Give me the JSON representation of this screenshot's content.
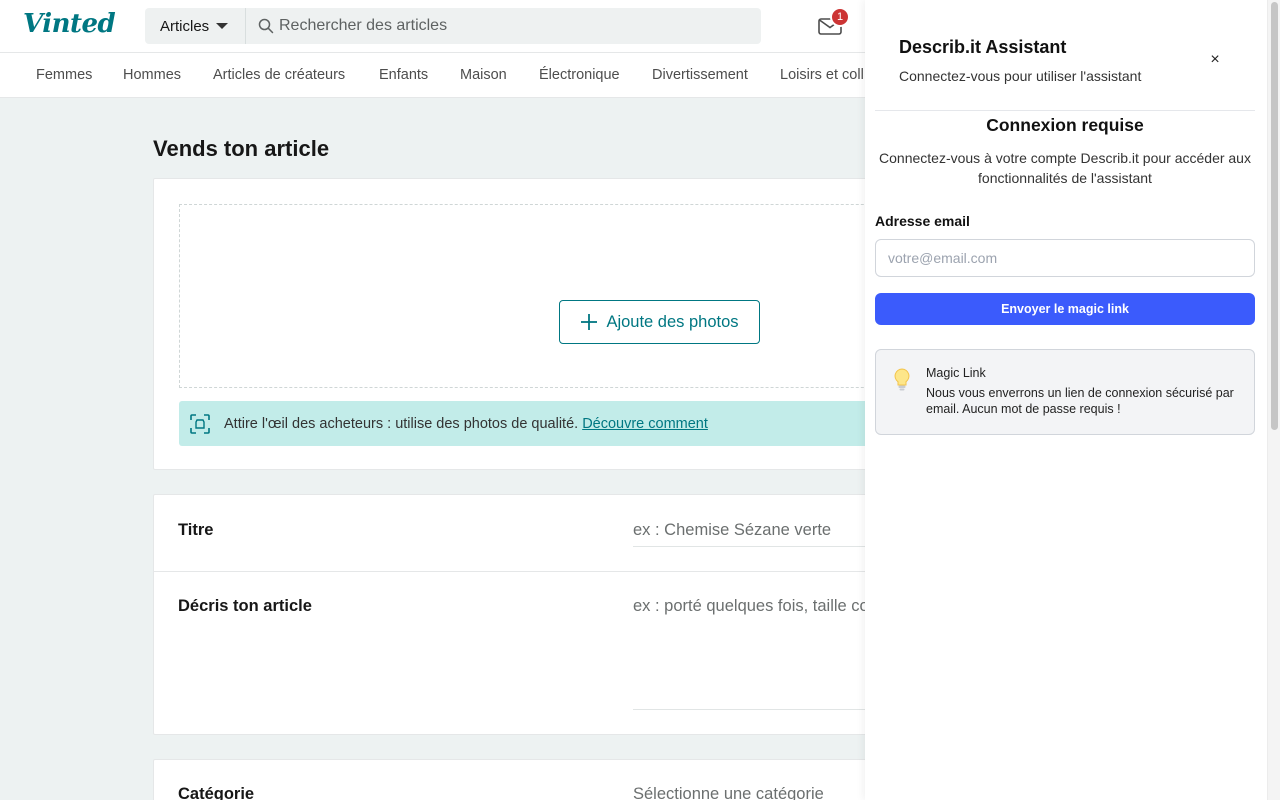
{
  "header": {
    "logo": "Vinted",
    "search_category": "Articles",
    "search_placeholder": "Rechercher des articles",
    "inbox_badge": "1"
  },
  "nav": {
    "items": [
      "Femmes",
      "Hommes",
      "Articles de créateurs",
      "Enfants",
      "Maison",
      "Électronique",
      "Divertissement",
      "Loisirs et coll"
    ]
  },
  "main": {
    "title": "Vends ton article",
    "add_photos_label": "Ajoute des photos",
    "tip_text": "Attire l'œil des acheteurs : utilise des photos de qualité.",
    "tip_link": "Découvre comment",
    "fields": {
      "title_label": "Titre",
      "title_placeholder": "ex : Chemise Sézane verte",
      "description_label": "Décris ton article",
      "description_placeholder": "ex : porté quelques fois, taille correctement",
      "category_label": "Catégorie",
      "category_placeholder": "Sélectionne une catégorie"
    }
  },
  "panel": {
    "title": "Describ.it Assistant",
    "subtitle": "Connectez-vous pour utiliser l'assistant",
    "close_icon": "×",
    "connect_title": "Connexion requise",
    "connect_desc": "Connectez-vous à votre compte Describ.it pour accéder aux fonctionnalités de l'assistant",
    "email_label": "Adresse email",
    "email_placeholder": "votre@email.com",
    "send_button": "Envoyer le magic link",
    "info_title": "Magic Link",
    "info_text": "Nous vous enverrons un lien de connexion sécurisé par email. Aucun mot de passe requis !"
  },
  "colors": {
    "brand": "#007782",
    "panel_button": "#3b5bfc",
    "badge": "#cc3434"
  }
}
